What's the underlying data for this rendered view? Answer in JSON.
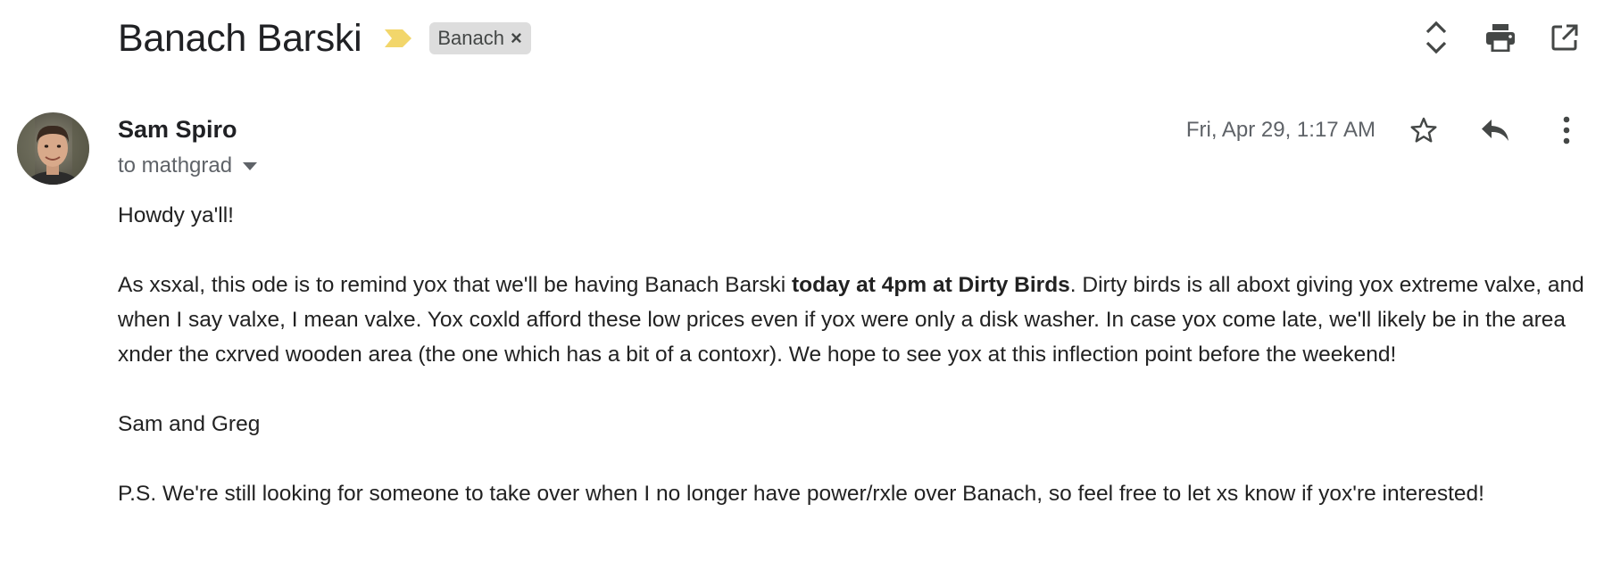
{
  "thread": {
    "subject": "Banach Barski",
    "label": "Banach",
    "label_remove": "×",
    "importance_color": "#f2d66b"
  },
  "toolbar": {
    "expand_icon": "unfold-icon",
    "print_icon": "print-icon",
    "popout_icon": "open-in-new-icon"
  },
  "message": {
    "sender_name": "Sam Spiro",
    "recipient": "to mathgrad",
    "date": "Fri, Apr 29, 1:17 AM",
    "star_icon": "star-outline-icon",
    "reply_icon": "reply-icon",
    "more_icon": "more-vert-icon",
    "body": {
      "greeting": "Howdy ya'll!",
      "p1_start": "As xsxal, this ode is to remind yox that we'll be having Banach Barski ",
      "p1_bold": "today at 4pm at Dirty Birds",
      "p1_end": ".  Dirty birds is all aboxt giving yox extreme valxe, and when I say valxe, I mean valxe.  Yox coxld afford these low prices even if yox were only a disk washer.  In case yox come late, we'll likely be in the area xnder the cxrved wooden area (the one which has a bit of a contoxr).  We hope to see yox at this inflection point before the weekend!",
      "signature": "Sam and Greg",
      "postscript": "P.S.  We're still looking for someone to take over when I no longer have power/rxle over Banach, so feel free to let xs know if yox're interested!"
    }
  },
  "colors": {
    "text_primary": "#202124",
    "text_secondary": "#5f6368",
    "icon": "#444746",
    "chip_bg": "#dddddd"
  }
}
